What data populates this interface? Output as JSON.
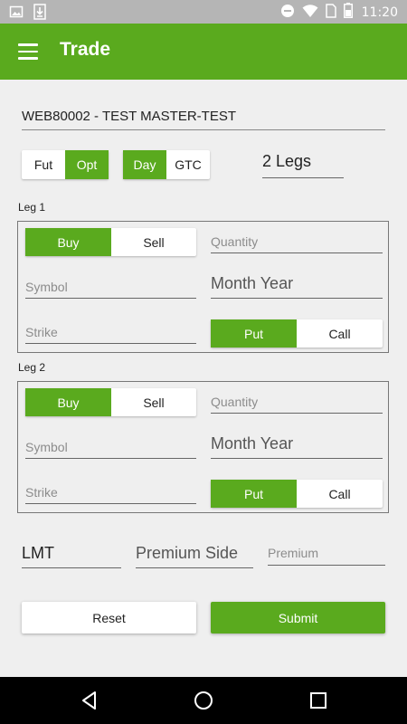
{
  "status_bar": {
    "time": "11:20",
    "left_icons": [
      "image-icon",
      "download-icon"
    ],
    "right_icons": [
      "dnd-icon",
      "wifi-icon",
      "sim-icon",
      "battery-icon"
    ]
  },
  "app_bar": {
    "title": "Trade"
  },
  "account": {
    "value": "WEB80002 - TEST MASTER-TEST"
  },
  "type_toggle": {
    "options": [
      "Fut",
      "Opt"
    ],
    "selected": "Opt"
  },
  "tif_toggle": {
    "options": [
      "Day",
      "GTC"
    ],
    "selected": "Day"
  },
  "legs_count": "2 Legs",
  "legs": [
    {
      "label": "Leg 1",
      "buy_label": "Buy",
      "sell_label": "Sell",
      "side_selected": "Buy",
      "quantity_placeholder": "Quantity",
      "symbol_placeholder": "Symbol",
      "month_year": "Month Year",
      "strike_placeholder": "Strike",
      "put_label": "Put",
      "call_label": "Call",
      "put_call_selected": "Put"
    },
    {
      "label": "Leg 2",
      "buy_label": "Buy",
      "sell_label": "Sell",
      "side_selected": "Buy",
      "quantity_placeholder": "Quantity",
      "symbol_placeholder": "Symbol",
      "month_year": "Month Year",
      "strike_placeholder": "Strike",
      "put_label": "Put",
      "call_label": "Call",
      "put_call_selected": "Put"
    }
  ],
  "order": {
    "order_type": "LMT",
    "premium_side": "Premium Side",
    "premium_placeholder": "Premium"
  },
  "actions": {
    "reset_label": "Reset",
    "submit_label": "Submit"
  },
  "colors": {
    "accent": "#5aaa1e",
    "status_bar": "#b5b5b5",
    "background": "#efefef"
  }
}
